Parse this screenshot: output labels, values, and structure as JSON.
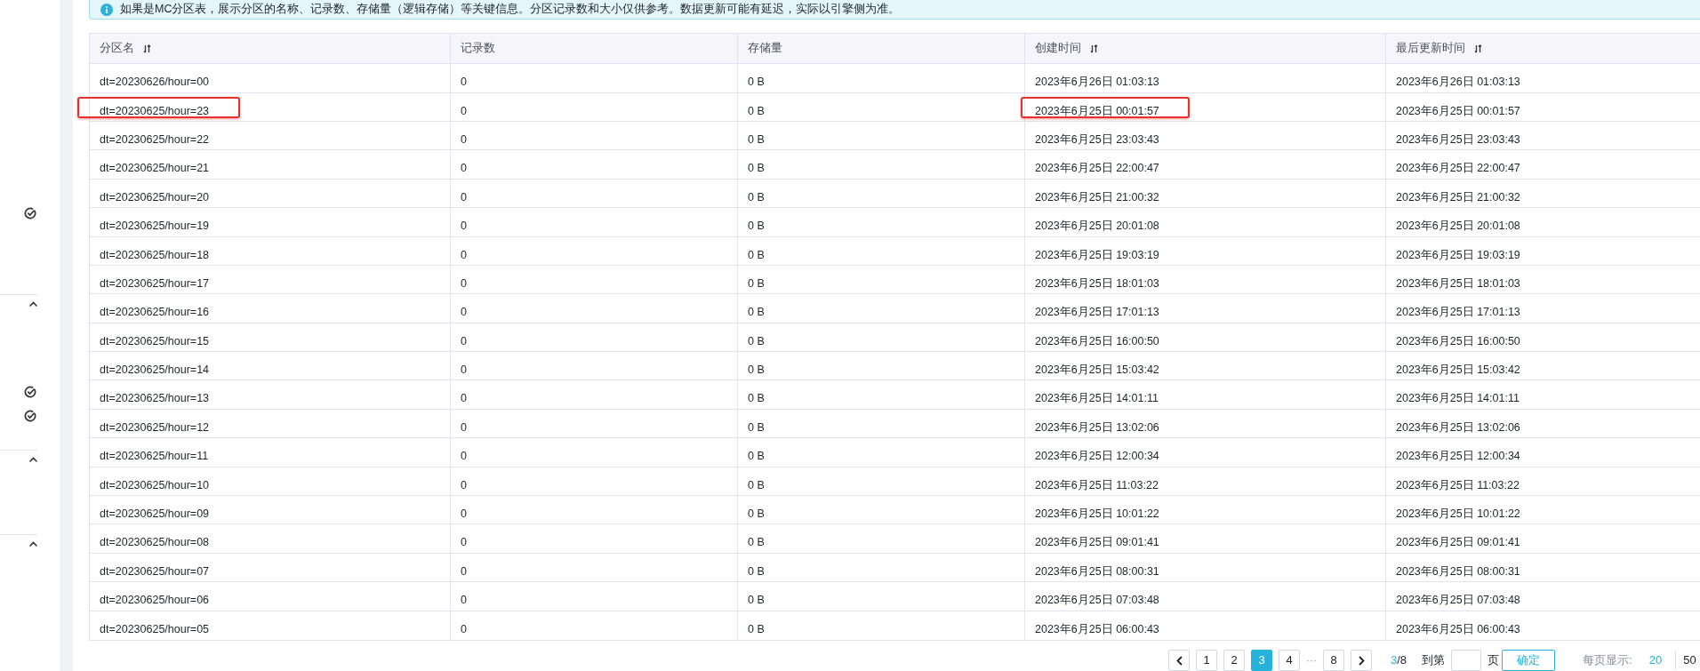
{
  "sidebar": {
    "items": [
      {
        "kind": "check"
      },
      {
        "kind": "caret"
      },
      {
        "kind": "check"
      },
      {
        "kind": "check"
      },
      {
        "kind": "caret"
      },
      {
        "kind": "caret"
      }
    ]
  },
  "notice": "如果是MC分区表，展示分区的名称、记录数、存储量（逻辑存储）等关键信息。分区记录数和大小仅供参考。数据更新可能有延迟，实际以引擎侧为准。",
  "table": {
    "columns": [
      {
        "label": "分区名",
        "sortable": true
      },
      {
        "label": "记录数",
        "sortable": false
      },
      {
        "label": "存储量",
        "sortable": false
      },
      {
        "label": "创建时间",
        "sortable": true
      },
      {
        "label": "最后更新时间",
        "sortable": true
      }
    ],
    "rows": [
      {
        "cells": [
          "dt=20230626/hour=00",
          "0",
          "0 B",
          "2023年6月26日 01:03:13",
          "2023年6月26日 01:03:13"
        ],
        "annotated": false
      },
      {
        "cells": [
          "dt=20230625/hour=23",
          "0",
          "0 B",
          "2023年6月25日 00:01:57",
          "2023年6月25日 00:01:57"
        ],
        "annotated": true
      },
      {
        "cells": [
          "dt=20230625/hour=22",
          "0",
          "0 B",
          "2023年6月25日 23:03:43",
          "2023年6月25日 23:03:43"
        ],
        "annotated": false
      },
      {
        "cells": [
          "dt=20230625/hour=21",
          "0",
          "0 B",
          "2023年6月25日 22:00:47",
          "2023年6月25日 22:00:47"
        ],
        "annotated": false
      },
      {
        "cells": [
          "dt=20230625/hour=20",
          "0",
          "0 B",
          "2023年6月25日 21:00:32",
          "2023年6月25日 21:00:32"
        ],
        "annotated": false
      },
      {
        "cells": [
          "dt=20230625/hour=19",
          "0",
          "0 B",
          "2023年6月25日 20:01:08",
          "2023年6月25日 20:01:08"
        ],
        "annotated": false
      },
      {
        "cells": [
          "dt=20230625/hour=18",
          "0",
          "0 B",
          "2023年6月25日 19:03:19",
          "2023年6月25日 19:03:19"
        ],
        "annotated": false
      },
      {
        "cells": [
          "dt=20230625/hour=17",
          "0",
          "0 B",
          "2023年6月25日 18:01:03",
          "2023年6月25日 18:01:03"
        ],
        "annotated": false
      },
      {
        "cells": [
          "dt=20230625/hour=16",
          "0",
          "0 B",
          "2023年6月25日 17:01:13",
          "2023年6月25日 17:01:13"
        ],
        "annotated": false
      },
      {
        "cells": [
          "dt=20230625/hour=15",
          "0",
          "0 B",
          "2023年6月25日 16:00:50",
          "2023年6月25日 16:00:50"
        ],
        "annotated": false
      },
      {
        "cells": [
          "dt=20230625/hour=14",
          "0",
          "0 B",
          "2023年6月25日 15:03:42",
          "2023年6月25日 15:03:42"
        ],
        "annotated": false
      },
      {
        "cells": [
          "dt=20230625/hour=13",
          "0",
          "0 B",
          "2023年6月25日 14:01:11",
          "2023年6月25日 14:01:11"
        ],
        "annotated": false
      },
      {
        "cells": [
          "dt=20230625/hour=12",
          "0",
          "0 B",
          "2023年6月25日 13:02:06",
          "2023年6月25日 13:02:06"
        ],
        "annotated": false
      },
      {
        "cells": [
          "dt=20230625/hour=11",
          "0",
          "0 B",
          "2023年6月25日 12:00:34",
          "2023年6月25日 12:00:34"
        ],
        "annotated": false
      },
      {
        "cells": [
          "dt=20230625/hour=10",
          "0",
          "0 B",
          "2023年6月25日 11:03:22",
          "2023年6月25日 11:03:22"
        ],
        "annotated": false
      },
      {
        "cells": [
          "dt=20230625/hour=09",
          "0",
          "0 B",
          "2023年6月25日 10:01:22",
          "2023年6月25日 10:01:22"
        ],
        "annotated": false
      },
      {
        "cells": [
          "dt=20230625/hour=08",
          "0",
          "0 B",
          "2023年6月25日 09:01:41",
          "2023年6月25日 09:01:41"
        ],
        "annotated": false
      },
      {
        "cells": [
          "dt=20230625/hour=07",
          "0",
          "0 B",
          "2023年6月25日 08:00:31",
          "2023年6月25日 08:00:31"
        ],
        "annotated": false
      },
      {
        "cells": [
          "dt=20230625/hour=06",
          "0",
          "0 B",
          "2023年6月25日 07:03:48",
          "2023年6月25日 07:03:48"
        ],
        "annotated": false
      },
      {
        "cells": [
          "dt=20230625/hour=05",
          "0",
          "0 B",
          "2023年6月25日 06:00:43",
          "2023年6月25日 06:00:43"
        ],
        "annotated": false
      }
    ]
  },
  "pagination": {
    "pages": [
      {
        "label": "1",
        "kind": "page",
        "selected": false
      },
      {
        "label": "2",
        "kind": "page",
        "selected": false
      },
      {
        "label": "3",
        "kind": "page",
        "selected": true
      },
      {
        "label": "4",
        "kind": "page",
        "selected": false
      },
      {
        "label": "···",
        "kind": "ellipsis"
      },
      {
        "label": "8",
        "kind": "page",
        "selected": false
      }
    ],
    "current": "3",
    "total": "/8",
    "goto_label": "到第",
    "page_unit": "页",
    "confirm": "确定",
    "page_size_label": "每页显示:",
    "page_sizes": [
      {
        "label": "20",
        "selected": true
      },
      {
        "label": "50",
        "selected": false
      }
    ]
  }
}
